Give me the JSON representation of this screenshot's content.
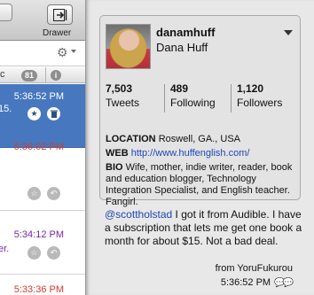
{
  "toolbar": {
    "drawer_label": "Drawer"
  },
  "column": {
    "header_letter": "c",
    "unread_count": "81",
    "info_glyph": "i"
  },
  "timeline": [
    {
      "time": "5:36:52 PM",
      "snippet": "15.",
      "selected": true
    },
    {
      "time": "5:36:02 PM",
      "snippet": "",
      "selected": false
    },
    {
      "time": "5:34:12 PM",
      "snippet": "er.",
      "selected": false
    },
    {
      "time": "5:33:36 PM",
      "snippet": "",
      "selected": false
    }
  ],
  "profile": {
    "screen_name": "danamhuff",
    "full_name": "Dana Huff",
    "tweets_count": "7,503",
    "tweets_label": "Tweets",
    "following_count": "489",
    "following_label": "Following",
    "followers_count": "1,120",
    "followers_label": "Followers",
    "location_key": "LOCATION",
    "location": "Roswell, GA., USA",
    "web_key": "WEB",
    "web": "http://www.huffenglish.com/",
    "bio_key": "BIO",
    "bio": "Wife, mother, indie writer, reader, book and education blogger, Technology Integration Specialist, and English teacher.",
    "bio_tail": "Fangirl."
  },
  "tweet": {
    "mention": "@scottholstad",
    "text": " I got it from Audible. I have a subscription that lets me get one book a month for about $15. Not a bad deal.",
    "source": "from YoruFukurou",
    "time": "5:36:52 PM"
  },
  "colors": {
    "selection": "#4778bf",
    "time_red": "#d33c2f",
    "time_purple": "#7b25a8",
    "link": "#1d47b8"
  },
  "icons": [
    "drawer-icon",
    "gear-icon",
    "star-icon",
    "trash-icon",
    "reply-icon",
    "info-icon",
    "apple-icon",
    "conversation-icon",
    "disclosure-caret-icon"
  ]
}
